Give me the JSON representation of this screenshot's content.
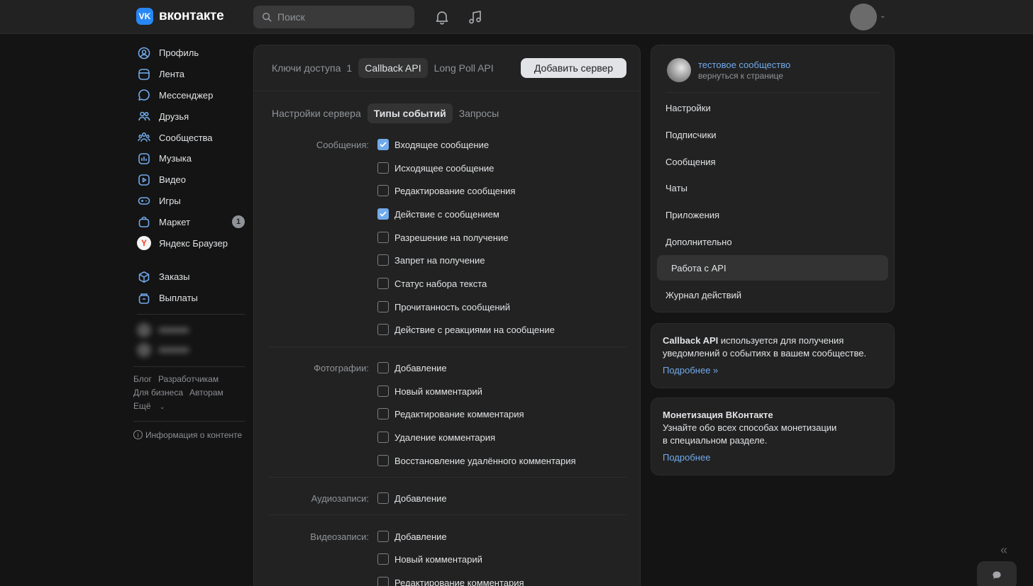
{
  "header": {
    "logo_letters": "VK",
    "logo_text": "вконтакте",
    "search_placeholder": "Поиск",
    "icons": [
      "bell-icon",
      "music-icon"
    ]
  },
  "sidebar": {
    "items": [
      {
        "label": "Профиль",
        "icon": "user-icon"
      },
      {
        "label": "Лента",
        "icon": "feed-icon"
      },
      {
        "label": "Мессенджер",
        "icon": "message-icon"
      },
      {
        "label": "Друзья",
        "icon": "friends-icon"
      },
      {
        "label": "Сообщества",
        "icon": "communities-icon"
      },
      {
        "label": "Музыка",
        "icon": "music-icon"
      },
      {
        "label": "Видео",
        "icon": "video-icon"
      },
      {
        "label": "Игры",
        "icon": "gamepad-icon"
      },
      {
        "label": "Маркет",
        "icon": "market-icon",
        "badge": "1"
      },
      {
        "label": "Яндекс Браузер",
        "icon": "yandex-icon"
      }
    ],
    "extra_items": [
      {
        "label": "Заказы",
        "icon": "box-icon"
      },
      {
        "label": "Выплаты",
        "icon": "payout-icon"
      }
    ],
    "footer_links": [
      "Блог",
      "Разработчикам",
      "Для бизнеса",
      "Авторам",
      "Ещё"
    ],
    "info_link": "Информация о контенте"
  },
  "main": {
    "top_tabs": [
      {
        "label": "Ключи доступа",
        "count": "1",
        "active": false
      },
      {
        "label": "Callback API",
        "active": true
      },
      {
        "label": "Long Poll API",
        "active": false
      }
    ],
    "add_server_label": "Добавить сервер",
    "sub_tabs": [
      {
        "label": "Настройки сервера",
        "active": false
      },
      {
        "label": "Типы событий",
        "active": true
      },
      {
        "label": "Запросы",
        "active": false
      }
    ],
    "groups": [
      {
        "label": "Сообщения:",
        "items": [
          {
            "label": "Входящее сообщение",
            "checked": true
          },
          {
            "label": "Исходящее сообщение",
            "checked": false
          },
          {
            "label": "Редактирование сообщения",
            "checked": false
          },
          {
            "label": "Действие с сообщением",
            "checked": true
          },
          {
            "label": "Разрешение на получение",
            "checked": false
          },
          {
            "label": "Запрет на получение",
            "checked": false
          },
          {
            "label": "Статус набора текста",
            "checked": false
          },
          {
            "label": "Прочитанность сообщений",
            "checked": false
          },
          {
            "label": "Действие с реакциями на сообщение",
            "checked": false
          }
        ]
      },
      {
        "label": "Фотографии:",
        "items": [
          {
            "label": "Добавление",
            "checked": false
          },
          {
            "label": "Новый комментарий",
            "checked": false
          },
          {
            "label": "Редактирование комментария",
            "checked": false
          },
          {
            "label": "Удаление комментария",
            "checked": false
          },
          {
            "label": "Восстановление удалённого комментария",
            "checked": false
          }
        ]
      },
      {
        "label": "Аудиозаписи:",
        "items": [
          {
            "label": "Добавление",
            "checked": false
          }
        ]
      },
      {
        "label": "Видеозаписи:",
        "items": [
          {
            "label": "Добавление",
            "checked": false
          },
          {
            "label": "Новый комментарий",
            "checked": false
          },
          {
            "label": "Редактирование комментария",
            "checked": false
          }
        ]
      }
    ]
  },
  "right": {
    "community_name": "тестовое сообщество",
    "back_label": "вернуться к странице",
    "menu": [
      {
        "label": "Настройки",
        "active": false
      },
      {
        "label": "Подписчики",
        "active": false
      },
      {
        "label": "Сообщения",
        "active": false
      },
      {
        "label": "Чаты",
        "active": false
      },
      {
        "label": "Приложения",
        "active": false
      },
      {
        "label": "Дополнительно",
        "active": false
      },
      {
        "label": "Работа с API",
        "active": true
      },
      {
        "label": "Журнал действий",
        "active": false
      }
    ],
    "callback_card": {
      "bold": "Callback API",
      "text": " используется для получения уведомлений о событиях в вашем сообществе.",
      "link": "Подробнее »"
    },
    "monetization_card": {
      "title": "Монетизация ВКонтакте",
      "line1": "Узнайте обо всех способах монетизации",
      "line2": "в специальном разделе.",
      "link": "Подробнее"
    }
  },
  "colors": {
    "accent": "#71aaeb",
    "background": "#141414",
    "panel": "#222222",
    "brand": "#2787f5"
  }
}
